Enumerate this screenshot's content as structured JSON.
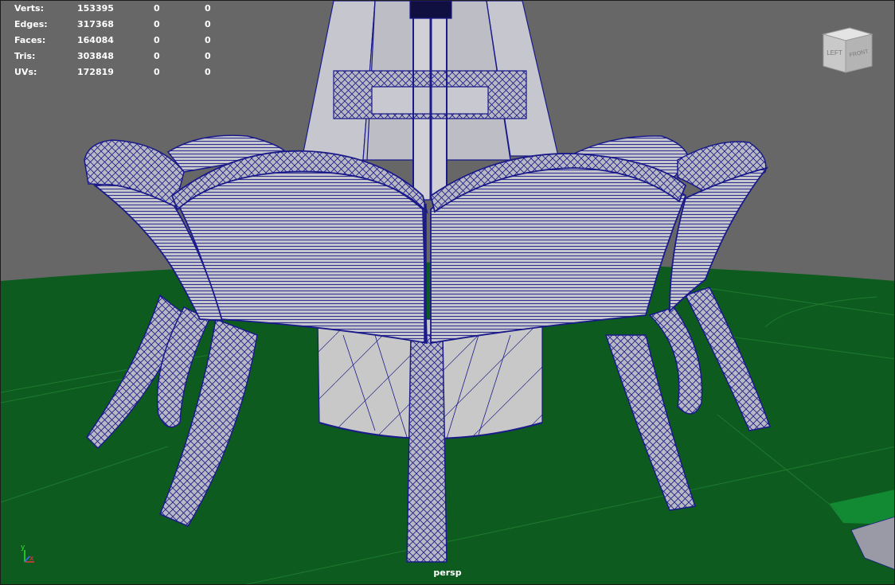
{
  "stats": {
    "rows": [
      {
        "label": "Verts:",
        "total": "153395",
        "selected": "0",
        "component": "0"
      },
      {
        "label": "Edges:",
        "total": "317368",
        "selected": "0",
        "component": "0"
      },
      {
        "label": "Faces:",
        "total": "164084",
        "selected": "0",
        "component": "0"
      },
      {
        "label": "Tris:",
        "total": "303848",
        "selected": "0",
        "component": "0"
      },
      {
        "label": "UVs:",
        "total": "172819",
        "selected": "0",
        "component": "0"
      }
    ]
  },
  "viewcube": {
    "left": "LEFT",
    "front": "FRONT"
  },
  "camera": {
    "name": "persp"
  },
  "axis": {
    "x": "x",
    "y": "y"
  },
  "colors": {
    "background": "#676767",
    "ground": "#0d5b1f",
    "ground_highlight": "#128a33",
    "mesh_fill": "#c4c4cc",
    "wireframe": "#1a1a8a"
  }
}
